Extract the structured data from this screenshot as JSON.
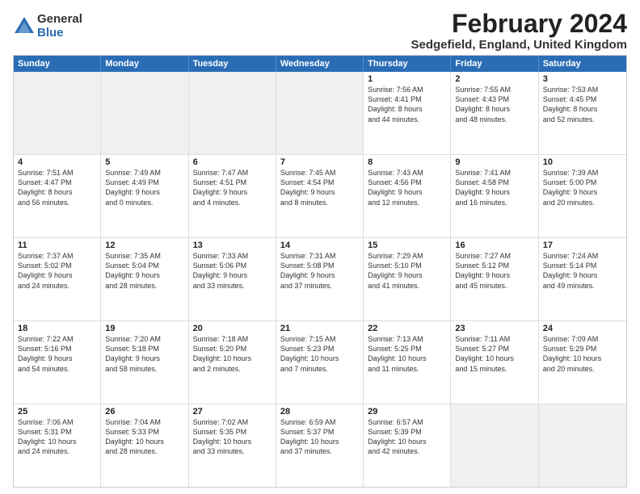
{
  "logo": {
    "general": "General",
    "blue": "Blue"
  },
  "title": "February 2024",
  "subtitle": "Sedgefield, England, United Kingdom",
  "header_days": [
    "Sunday",
    "Monday",
    "Tuesday",
    "Wednesday",
    "Thursday",
    "Friday",
    "Saturday"
  ],
  "rows": [
    [
      {
        "day": "",
        "info": "",
        "shaded": true
      },
      {
        "day": "",
        "info": "",
        "shaded": true
      },
      {
        "day": "",
        "info": "",
        "shaded": true
      },
      {
        "day": "",
        "info": "",
        "shaded": true
      },
      {
        "day": "1",
        "info": "Sunrise: 7:56 AM\nSunset: 4:41 PM\nDaylight: 8 hours\nand 44 minutes."
      },
      {
        "day": "2",
        "info": "Sunrise: 7:55 AM\nSunset: 4:43 PM\nDaylight: 8 hours\nand 48 minutes."
      },
      {
        "day": "3",
        "info": "Sunrise: 7:53 AM\nSunset: 4:45 PM\nDaylight: 8 hours\nand 52 minutes."
      }
    ],
    [
      {
        "day": "4",
        "info": "Sunrise: 7:51 AM\nSunset: 4:47 PM\nDaylight: 8 hours\nand 56 minutes."
      },
      {
        "day": "5",
        "info": "Sunrise: 7:49 AM\nSunset: 4:49 PM\nDaylight: 9 hours\nand 0 minutes."
      },
      {
        "day": "6",
        "info": "Sunrise: 7:47 AM\nSunset: 4:51 PM\nDaylight: 9 hours\nand 4 minutes."
      },
      {
        "day": "7",
        "info": "Sunrise: 7:45 AM\nSunset: 4:54 PM\nDaylight: 9 hours\nand 8 minutes."
      },
      {
        "day": "8",
        "info": "Sunrise: 7:43 AM\nSunset: 4:56 PM\nDaylight: 9 hours\nand 12 minutes."
      },
      {
        "day": "9",
        "info": "Sunrise: 7:41 AM\nSunset: 4:58 PM\nDaylight: 9 hours\nand 16 minutes."
      },
      {
        "day": "10",
        "info": "Sunrise: 7:39 AM\nSunset: 5:00 PM\nDaylight: 9 hours\nand 20 minutes."
      }
    ],
    [
      {
        "day": "11",
        "info": "Sunrise: 7:37 AM\nSunset: 5:02 PM\nDaylight: 9 hours\nand 24 minutes."
      },
      {
        "day": "12",
        "info": "Sunrise: 7:35 AM\nSunset: 5:04 PM\nDaylight: 9 hours\nand 28 minutes."
      },
      {
        "day": "13",
        "info": "Sunrise: 7:33 AM\nSunset: 5:06 PM\nDaylight: 9 hours\nand 33 minutes."
      },
      {
        "day": "14",
        "info": "Sunrise: 7:31 AM\nSunset: 5:08 PM\nDaylight: 9 hours\nand 37 minutes."
      },
      {
        "day": "15",
        "info": "Sunrise: 7:29 AM\nSunset: 5:10 PM\nDaylight: 9 hours\nand 41 minutes."
      },
      {
        "day": "16",
        "info": "Sunrise: 7:27 AM\nSunset: 5:12 PM\nDaylight: 9 hours\nand 45 minutes."
      },
      {
        "day": "17",
        "info": "Sunrise: 7:24 AM\nSunset: 5:14 PM\nDaylight: 9 hours\nand 49 minutes."
      }
    ],
    [
      {
        "day": "18",
        "info": "Sunrise: 7:22 AM\nSunset: 5:16 PM\nDaylight: 9 hours\nand 54 minutes."
      },
      {
        "day": "19",
        "info": "Sunrise: 7:20 AM\nSunset: 5:18 PM\nDaylight: 9 hours\nand 58 minutes."
      },
      {
        "day": "20",
        "info": "Sunrise: 7:18 AM\nSunset: 5:20 PM\nDaylight: 10 hours\nand 2 minutes."
      },
      {
        "day": "21",
        "info": "Sunrise: 7:15 AM\nSunset: 5:23 PM\nDaylight: 10 hours\nand 7 minutes."
      },
      {
        "day": "22",
        "info": "Sunrise: 7:13 AM\nSunset: 5:25 PM\nDaylight: 10 hours\nand 11 minutes."
      },
      {
        "day": "23",
        "info": "Sunrise: 7:11 AM\nSunset: 5:27 PM\nDaylight: 10 hours\nand 15 minutes."
      },
      {
        "day": "24",
        "info": "Sunrise: 7:09 AM\nSunset: 5:29 PM\nDaylight: 10 hours\nand 20 minutes."
      }
    ],
    [
      {
        "day": "25",
        "info": "Sunrise: 7:06 AM\nSunset: 5:31 PM\nDaylight: 10 hours\nand 24 minutes."
      },
      {
        "day": "26",
        "info": "Sunrise: 7:04 AM\nSunset: 5:33 PM\nDaylight: 10 hours\nand 28 minutes."
      },
      {
        "day": "27",
        "info": "Sunrise: 7:02 AM\nSunset: 5:35 PM\nDaylight: 10 hours\nand 33 minutes."
      },
      {
        "day": "28",
        "info": "Sunrise: 6:59 AM\nSunset: 5:37 PM\nDaylight: 10 hours\nand 37 minutes."
      },
      {
        "day": "29",
        "info": "Sunrise: 6:57 AM\nSunset: 5:39 PM\nDaylight: 10 hours\nand 42 minutes."
      },
      {
        "day": "",
        "info": "",
        "shaded": true
      },
      {
        "day": "",
        "info": "",
        "shaded": true
      }
    ]
  ]
}
